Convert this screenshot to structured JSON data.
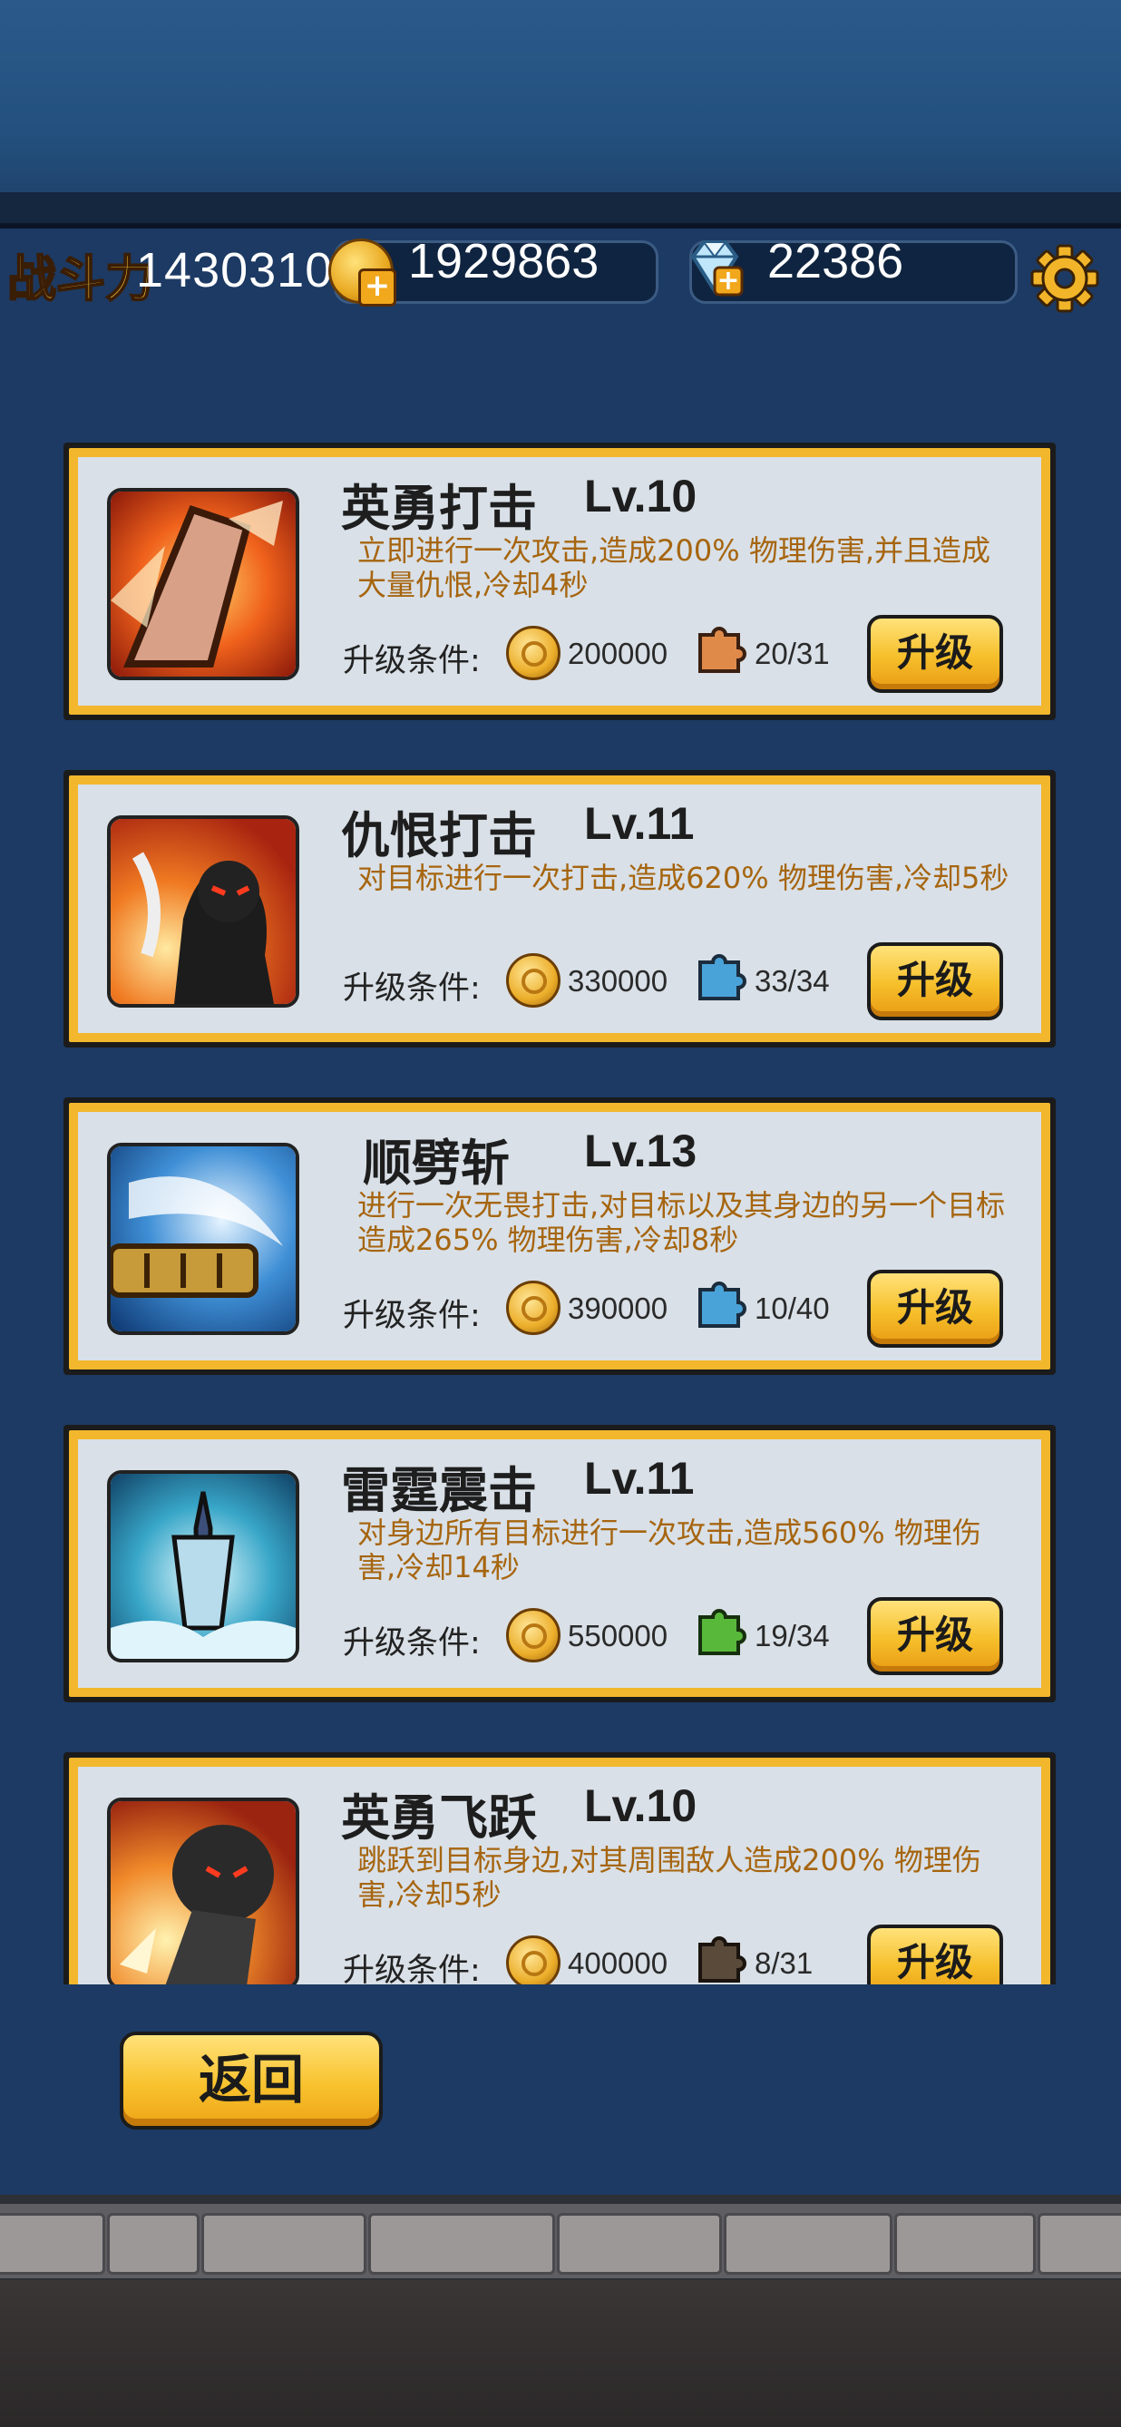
{
  "stats": {
    "power_label": "战斗力",
    "power_value": "1430310",
    "gold_value": "1929863",
    "diamond_value": "22386"
  },
  "requirement_label": "升级条件:",
  "upgrade_label": "升级",
  "skills": [
    {
      "name": "英勇打击",
      "level": "Lv.10",
      "description": "立即进行一次攻击,造成200% 物理伤害,并且造成大量仇恨,冷却4秒",
      "gold_cost": "200000",
      "fragments": "20/31",
      "fragment_color": "#e08a4a",
      "icon": "shield-strike-icon"
    },
    {
      "name": "仇恨打击",
      "level": "Lv.11",
      "description": "对目标进行一次打击,造成620% 物理伤害,冷却5秒",
      "gold_cost": "330000",
      "fragments": "33/34",
      "fragment_color": "#4aa3d8",
      "icon": "dark-warrior-icon"
    },
    {
      "name": "顺劈斩",
      "level": "Lv.13",
      "description": "进行一次无畏打击,对目标以及其身边的另一个目标造成265% 物理伤害,冷却8秒",
      "gold_cost": "390000",
      "fragments": "10/40",
      "fragment_color": "#4aa3d8",
      "icon": "cleave-slash-icon"
    },
    {
      "name": "雷霆震击",
      "level": "Lv.11",
      "description": "对身边所有目标进行一次攻击,造成560% 物理伤害,冷却14秒",
      "gold_cost": "550000",
      "fragments": "19/34",
      "fragment_color": "#58b83a",
      "icon": "thunder-sword-icon"
    },
    {
      "name": "英勇飞跃",
      "level": "Lv.10",
      "description": "跳跃到目标身边,对其周围敌人造成200% 物理伤害,冷却5秒",
      "gold_cost": "400000",
      "fragments": "8/31",
      "fragment_color": "#5a4a3a",
      "icon": "heroic-leap-icon"
    }
  ],
  "back_label": "返回",
  "colors": {
    "background": "#1c3a63",
    "card_border": "#f2b72c",
    "card_face": "#d9e0e7",
    "description_text": "#a6650f",
    "button_yellow": "#f6bf2a"
  }
}
